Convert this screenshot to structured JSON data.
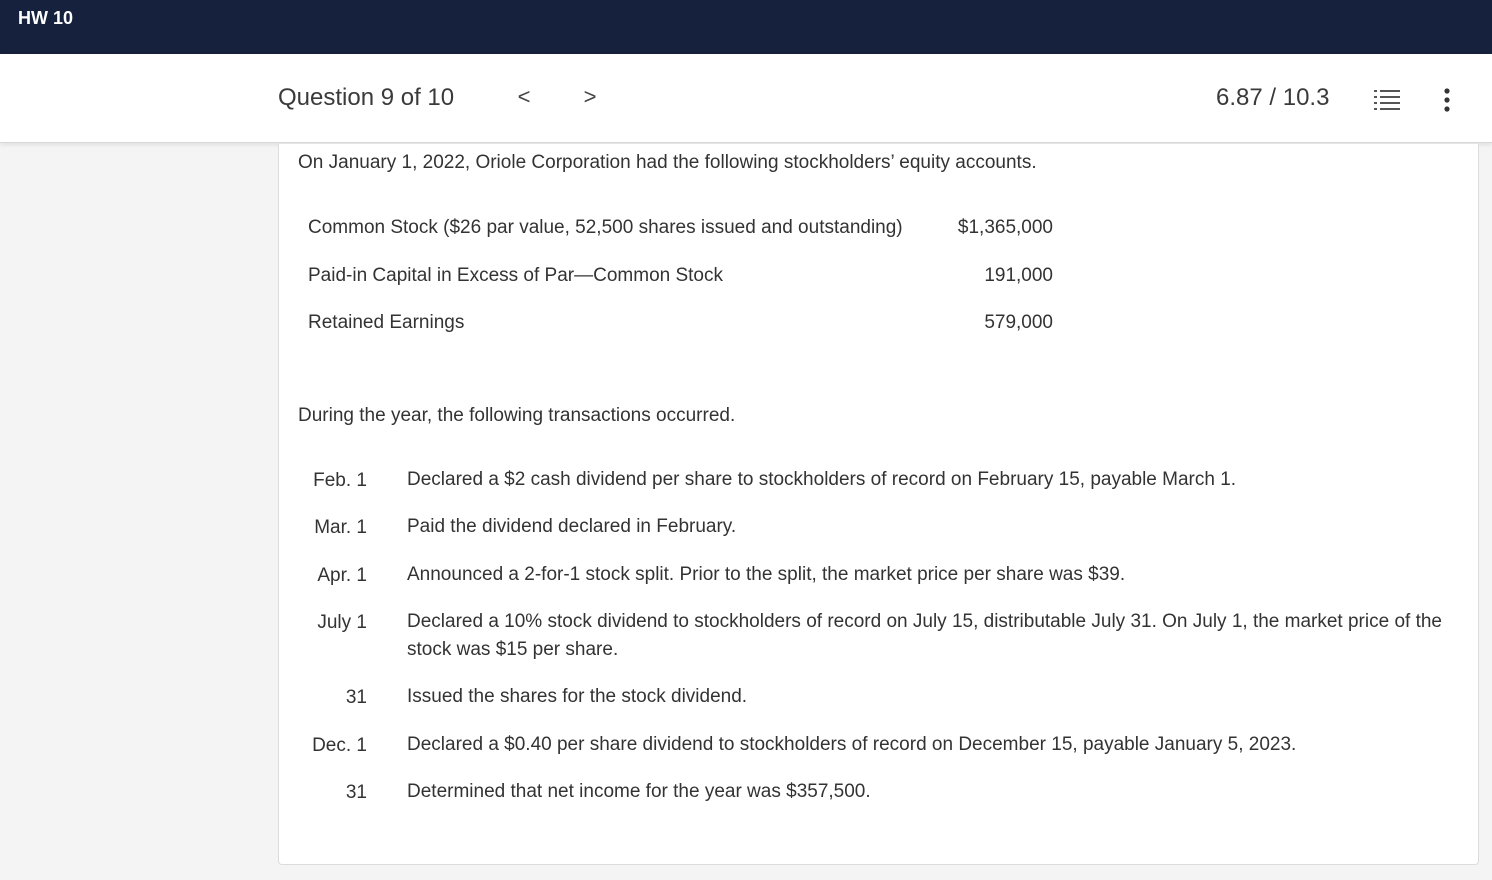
{
  "header": {
    "title": "HW 10"
  },
  "question_bar": {
    "question_label": "Question 9 of 10",
    "prev": "<",
    "next": ">",
    "score": "6.87 / 10.3",
    "list_icon": "list-icon",
    "more_icon": "more-vertical-icon"
  },
  "problem": {
    "intro": "On January 1, 2022, Oriole Corporation had the following stockholders’ equity accounts.",
    "accounts": [
      {
        "name": "Common Stock ($26 par value, 52,500 shares issued and outstanding)",
        "amount": "$1,365,000"
      },
      {
        "name": "Paid-in Capital in Excess of Par—Common Stock",
        "amount": "191,000"
      },
      {
        "name": "Retained Earnings",
        "amount": "579,000"
      }
    ],
    "transactions_intro": "During the year, the following transactions occurred.",
    "transactions": [
      {
        "date": "Feb. 1",
        "desc": "Declared a $2 cash dividend per share to stockholders of record on February 15, payable March 1."
      },
      {
        "date": "Mar. 1",
        "desc": "Paid the dividend declared in February."
      },
      {
        "date": "Apr. 1",
        "desc": "Announced a 2-for-1 stock split. Prior to the split, the market price per share was $39."
      },
      {
        "date": "July 1",
        "desc": "Declared a 10% stock dividend to stockholders of record on July 15, distributable July 31. On July 1, the market price of the stock was $15 per share."
      },
      {
        "date": "31",
        "desc": "Issued the shares for the stock dividend."
      },
      {
        "date": "Dec. 1",
        "desc": "Declared a $0.40 per share dividend to stockholders of record on December 15, payable January 5, 2023."
      },
      {
        "date": "31",
        "desc": "Determined that net income for the year was $357,500."
      }
    ]
  }
}
